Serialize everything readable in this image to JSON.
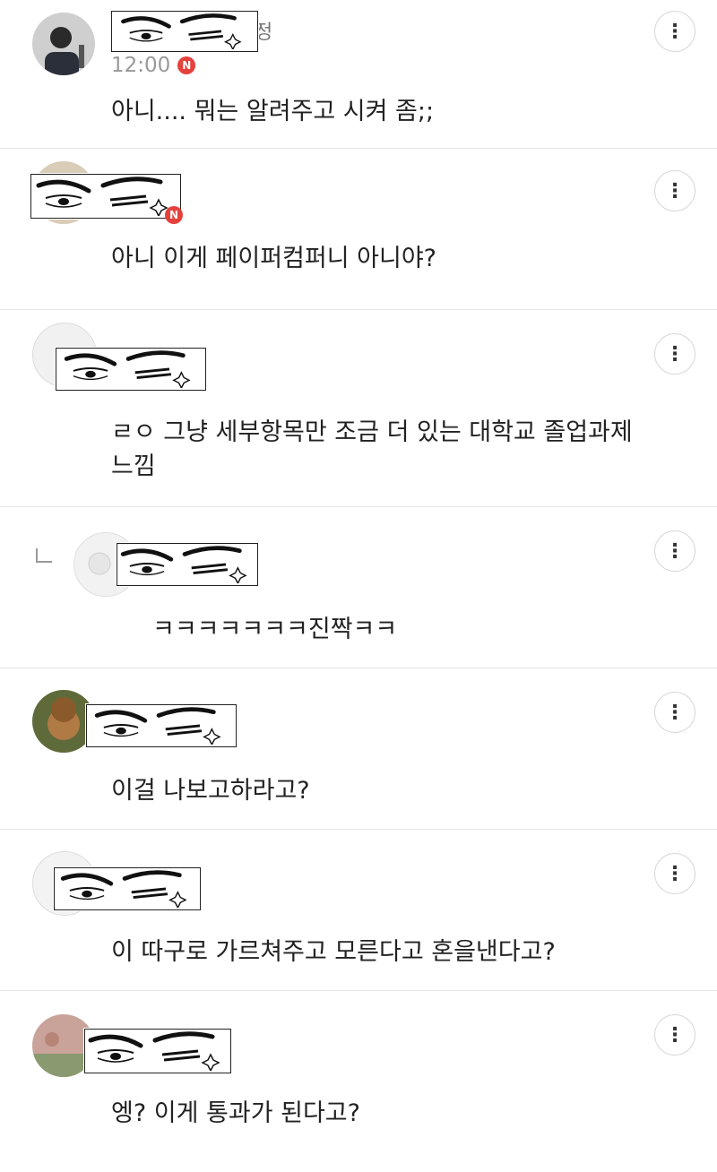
{
  "comments": [
    {
      "name_visible": "정",
      "time": "12:00",
      "badge": "N",
      "text": "아니.... 뭐는 알려주고 시켜 좀;;"
    },
    {
      "name_visible": "",
      "time": "",
      "badge": "N",
      "text": "아니 이게 페이퍼컴퍼니 아니야?"
    },
    {
      "name_visible": "",
      "time": "",
      "badge": "",
      "text": "ㄹㅇ 그냥 세부항목만 조금 더 있는 대학교 졸업과제\n느낌"
    },
    {
      "name_visible": "",
      "time": "",
      "badge": "",
      "text": "ㅋㅋㅋㅋㅋㅋㅋ진짝ㅋㅋ"
    },
    {
      "name_visible": "",
      "time": "",
      "badge": "",
      "text": "이걸 나보고하라고?"
    },
    {
      "name_visible": "",
      "time": "",
      "badge": "",
      "text": "이 따구로 가르쳐주고 모른다고 혼을낸다고?"
    },
    {
      "name_visible": "",
      "time": "",
      "badge": "",
      "text": "엥? 이게 통과가 된다고?"
    }
  ],
  "more_label": "⋮",
  "colors": {
    "badge": "#e5413c",
    "divider": "#e4e4e4",
    "time": "#999999"
  }
}
